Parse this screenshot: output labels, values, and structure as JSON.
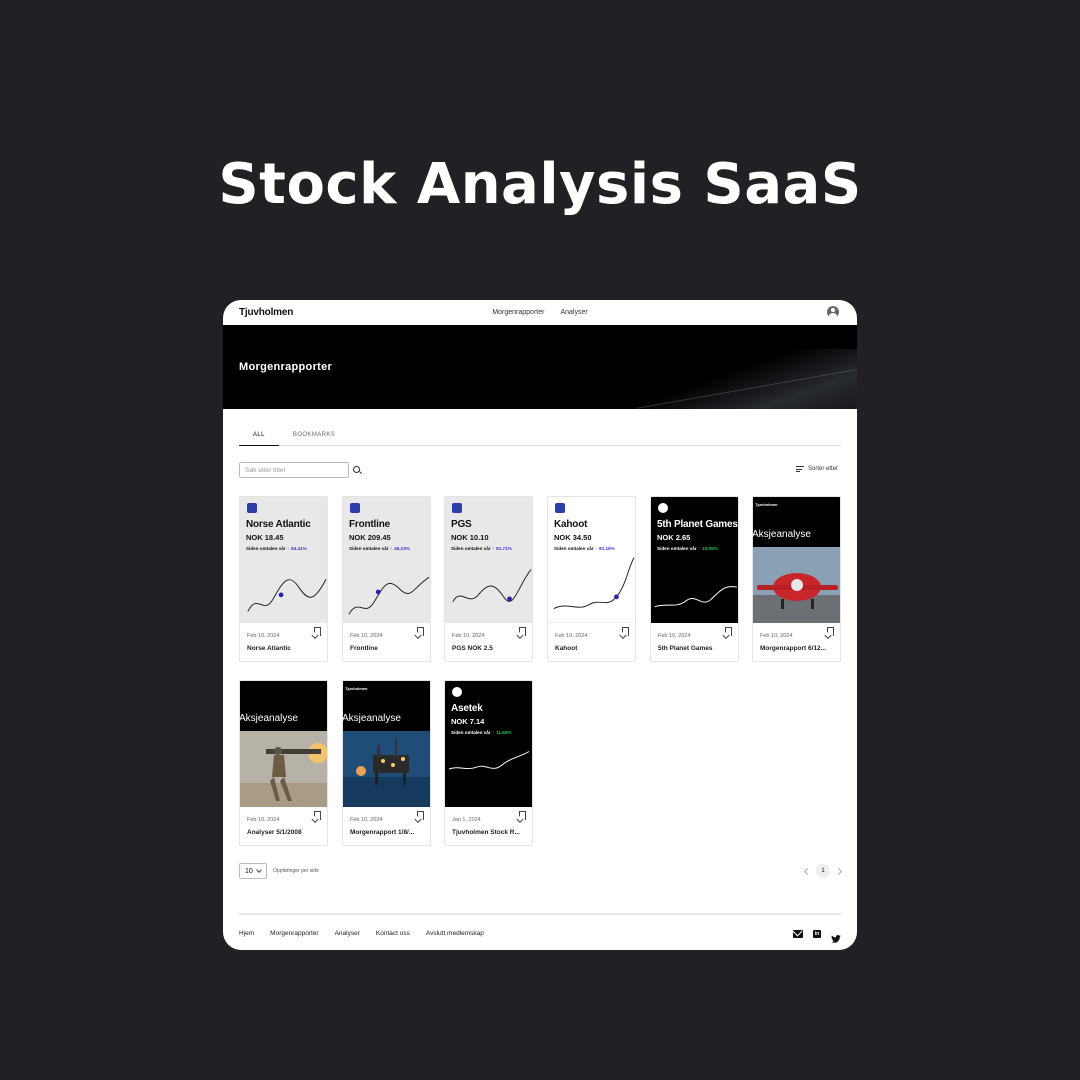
{
  "promo": {
    "title": "Stock Analysis SaaS"
  },
  "nav": {
    "brand": "Tjuvholmen",
    "links": [
      "Morgenrapporter",
      "Analyser"
    ]
  },
  "hero": {
    "title": "Morgenrapporter"
  },
  "tabs": [
    "ALL",
    "BOOKMARKS"
  ],
  "search": {
    "placeholder": "Søk etter tittel"
  },
  "sort": {
    "label": "Sorter etter"
  },
  "cards": [
    {
      "kind": "stock",
      "theme": "light",
      "name": "Norse Atlantic",
      "price": "NOK 18.45",
      "since": "Siden omtalen vår",
      "pct": "84.41%",
      "pct_color": "#3b30c4",
      "date": "Feb 10, 2024",
      "label": "Norse Atlantic"
    },
    {
      "kind": "stock",
      "theme": "light",
      "name": "Frontline",
      "price": "NOK 209.45",
      "since": "Siden omtalen vår",
      "pct": "46.23%",
      "pct_color": "#3b30c4",
      "date": "Feb 10, 2024",
      "label": "Frontline"
    },
    {
      "kind": "stock",
      "theme": "light",
      "name": "PGS",
      "price": "NOK 10.10",
      "since": "Siden omtalen vår",
      "pct": "81.71%",
      "pct_color": "#3b30c4",
      "date": "Feb 10, 2024",
      "label": "PGS NOK 2.5"
    },
    {
      "kind": "stock",
      "theme": "white",
      "name": "Kahoot",
      "price": "NOK 34.50",
      "since": "Siden omtalen vår",
      "pct": "81.16%",
      "pct_color": "#3b30c4",
      "date": "Feb 10, 2024",
      "label": "Kahoot"
    },
    {
      "kind": "stock",
      "theme": "dark",
      "name": "5th Planet Games",
      "price": "NOK 2.65",
      "since": "Siden omtalen vår",
      "pct": "23.05%",
      "pct_color": "#22c55e",
      "date": "Feb 10, 2024",
      "label": "5th Planet Games"
    },
    {
      "kind": "report",
      "brand": "Tjuvholmen",
      "title": "Aksjeanalyse",
      "photo": "plane",
      "date": "Feb 10, 2024",
      "label": "Morgenrapport 6/12..."
    },
    {
      "kind": "report",
      "brand": "",
      "title": "Aksjeanalyse",
      "photo": "soldier",
      "date": "Feb 10, 2024",
      "label": "Analyser 5/1/2008"
    },
    {
      "kind": "report",
      "brand": "Tjuvholmen",
      "title": "Aksjeanalyse",
      "photo": "rig",
      "date": "Feb 10, 2024",
      "label": "Morgenrapport 1/8/..."
    },
    {
      "kind": "stock",
      "theme": "dark",
      "name": "Asetek",
      "price": "NOK 7.14",
      "since": "Siden omtalen vår",
      "pct": "11.60%",
      "pct_color": "#22c55e",
      "date": "Jan 1, 2024",
      "label": "Tjuvholmen Stock R..."
    }
  ],
  "pagination": {
    "rows_value": "10",
    "rows_label": "Oppføringer per side",
    "page": "1"
  },
  "footer": {
    "links": [
      "Hjem",
      "Morgenrapporter",
      "Analyser",
      "Kontact oss",
      "Avslutt medlemskap"
    ],
    "social_icons": [
      "mail-icon",
      "linkedin-icon",
      "twitter-icon"
    ]
  },
  "colors": {
    "background": "#212125",
    "hero": "#000000",
    "accent_up": "#22c55e",
    "accent_brand": "#3b30c4"
  }
}
